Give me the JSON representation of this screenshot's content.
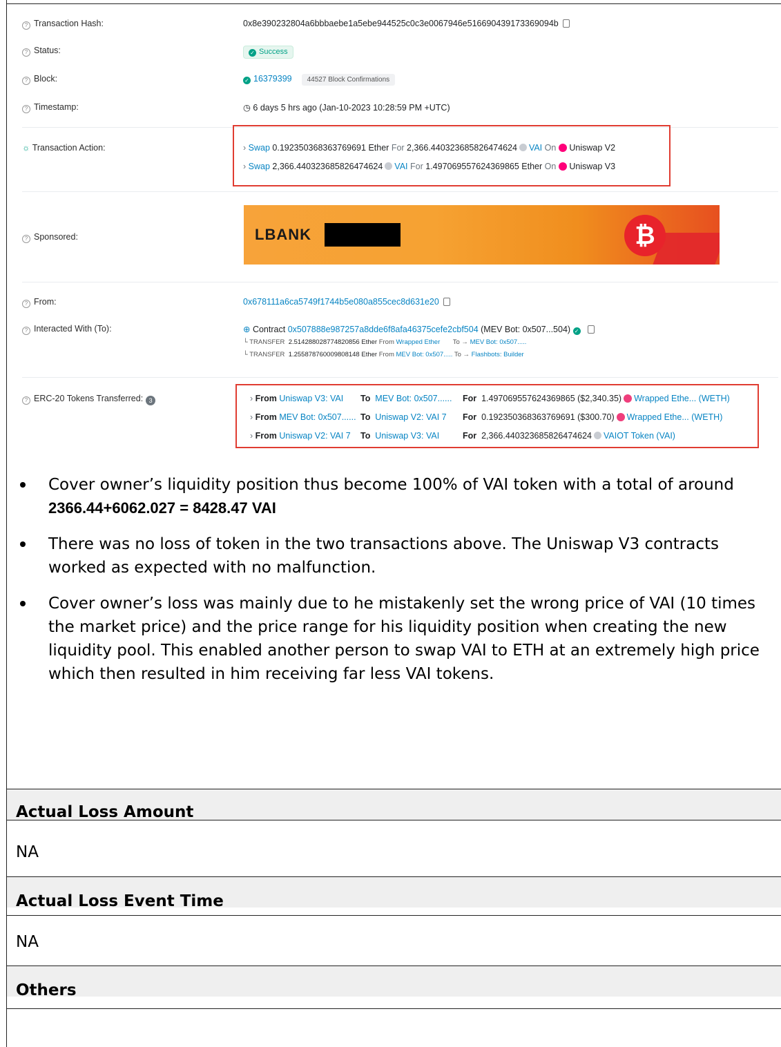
{
  "tx": {
    "hash_label": "Transaction Hash:",
    "hash": "0x8e390232804a6bbbaebe1a5ebe944525c0c3e0067946e516690439173369094b",
    "status_label": "Status:",
    "status": "Success",
    "block_label": "Block:",
    "block": "16379399",
    "confirmations": "44527 Block Confirmations",
    "timestamp_label": "Timestamp:",
    "timestamp": "6 days 5 hrs ago (Jan-10-2023 10:28:59 PM +UTC)",
    "action_label": "Transaction Action:",
    "actions": [
      {
        "swap": "Swap",
        "amount": "0.192350368363769691 Ether",
        "for": "For",
        "amount2": "2,366.440323685826474624",
        "token": "VAI",
        "on": "On",
        "dex": "Uniswap V2"
      },
      {
        "swap": "Swap",
        "amount": "2,366.440323685826474624",
        "token": "VAI",
        "for": "For",
        "amount2": "1.497069557624369865 Ether",
        "on": "On",
        "dex": "Uniswap V3"
      }
    ],
    "sponsored_label": "Sponsored:",
    "sponsor_brand": "LBANK",
    "from_label": "From:",
    "from": "0x678111a6ca5749f1744b5e080a855cec8d631e20",
    "to_label": "Interacted With (To):",
    "contract_word": "Contract",
    "contract": "0x507888e987257a8dde6f8afa46375cefe2cbf504",
    "contract_name": "(MEV Bot: 0x507...504)",
    "transfers": [
      {
        "kind": "TRANSFER",
        "amount": "2.514288028774820856 Ether",
        "from_word": "From",
        "from": "Wrapped Ether",
        "to_word": "To",
        "to": "MEV Bot: 0x507....."
      },
      {
        "kind": "TRANSFER",
        "amount": "1.255878760009808148 Ether",
        "from_word": "From",
        "from": "MEV Bot: 0x507.....",
        "to_word": "To",
        "to": "Flashbots: Builder"
      }
    ],
    "erc20_label": "ERC-20 Tokens Transferred:",
    "erc20_count": "3",
    "erc20": [
      {
        "from": "Uniswap V3: VAI",
        "to": "MEV Bot: 0x507......",
        "amount": "1.497069557624369865",
        "usd": "($2,340.35)",
        "token": "Wrapped Ethe... (WETH)",
        "icon": "weth-icon"
      },
      {
        "from": "MEV Bot: 0x507......",
        "to": "Uniswap V2: VAI 7",
        "amount": "0.192350368363769691",
        "usd": "($300.70)",
        "token": "Wrapped Ethe... (WETH)",
        "icon": "weth-icon"
      },
      {
        "from": "Uniswap V2: VAI 7",
        "to": "Uniswap V3: VAI",
        "amount": "2,366.440323685826474624",
        "usd": "",
        "token": "VAIOT Token (VAI)",
        "icon": "vai-icon"
      }
    ],
    "from_word": "From",
    "to_word": "To",
    "for_word": "For"
  },
  "bullets": [
    {
      "text": "Cover owner’s liquidity position thus become 100% of VAI token with a total of around ",
      "bold": "2366.44+6062.027 = 8428.47 VAI"
    },
    {
      "text": "There was no loss of token in the two transactions above. The Uniswap V3 contracts worked as expected with no malfunction.",
      "bold": ""
    },
    {
      "text": "Cover owner’s loss was mainly due to he mistakenly set the wrong price of VAI (10 times the market price) and the price range for his liquidity position when creating the new liquidity pool. This enabled another person to swap VAI to ETH at an extremely high price which then resulted in him receiving far less VAI tokens.",
      "bold": ""
    }
  ],
  "table": {
    "loss_amount_header": "Actual Loss Amount",
    "loss_amount_value": "NA",
    "loss_time_header": "Actual Loss Event Time",
    "loss_time_value": "NA",
    "others_header": "Others",
    "others_value": ""
  },
  "colors": {
    "link": "#0784c3",
    "highlight_box": "#e03c31",
    "success": "#00a186"
  }
}
